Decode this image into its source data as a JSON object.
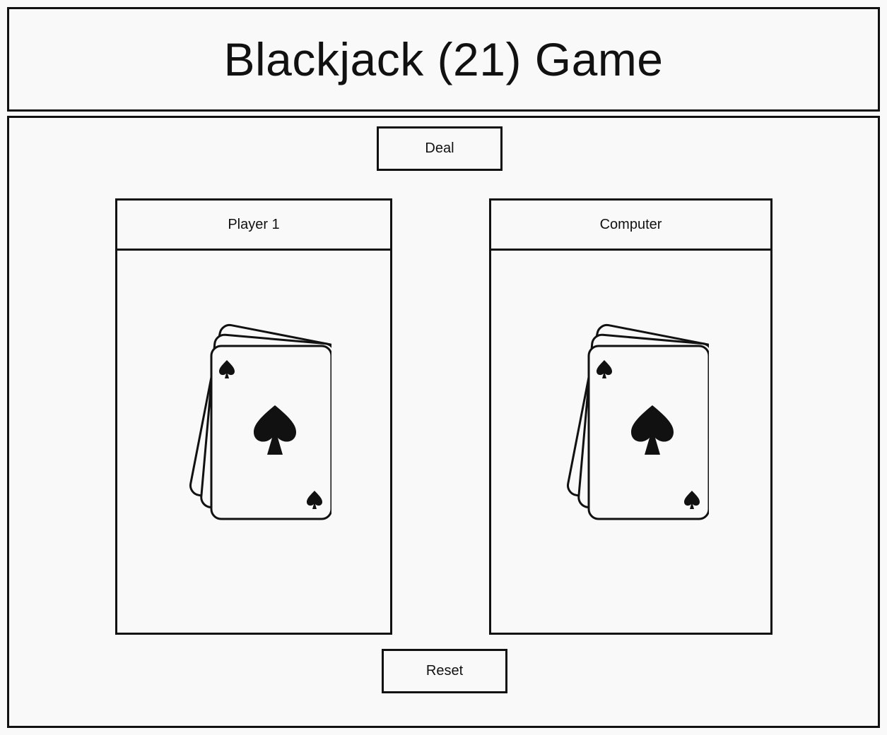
{
  "header": {
    "title": "Blackjack (21) Game"
  },
  "controls": {
    "deal_label": "Deal",
    "reset_label": "Reset"
  },
  "players": {
    "player": {
      "name": "Player 1",
      "icon": "playing-cards-spade-icon"
    },
    "computer": {
      "name": "Computer",
      "icon": "playing-cards-spade-icon"
    }
  }
}
